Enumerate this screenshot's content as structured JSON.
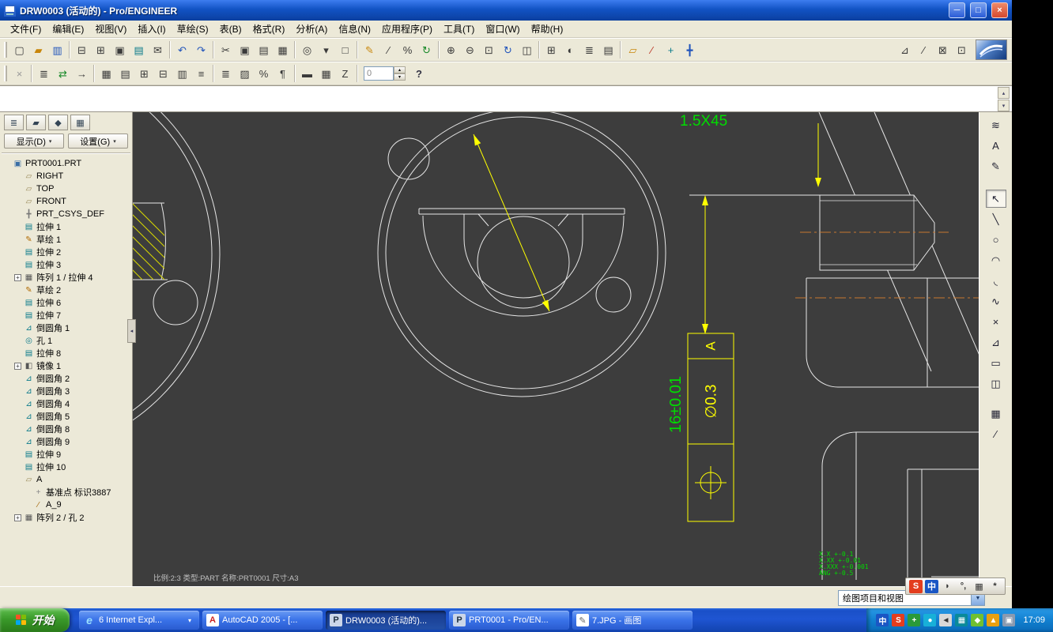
{
  "window": {
    "title": "DRW0003 (活动的) - Pro/ENGINEER"
  },
  "icons": {
    "minimize": "─",
    "maximize": "□",
    "close": "×",
    "caret_down": "▾",
    "combo_caret": "▼",
    "collapse_left": "◂",
    "scroll_up": "▴",
    "scroll_down": "▾",
    "spinner_up": "▴",
    "spinner_down": "▾",
    "help": "?"
  },
  "menu_bar": {
    "items": [
      "文件(F)",
      "编辑(E)",
      "视图(V)",
      "插入(I)",
      "草绘(S)",
      "表(B)",
      "格式(R)",
      "分析(A)",
      "信息(N)",
      "应用程序(P)",
      "工具(T)",
      "窗口(W)",
      "帮助(H)"
    ]
  },
  "toolbar_row1": {
    "groups": [
      [
        {
          "name": "new-file-button",
          "g": "▢",
          "c": "c-dark"
        },
        {
          "name": "open-file-button",
          "g": "▰",
          "c": "c-amber"
        },
        {
          "name": "save-file-button",
          "g": "▥",
          "c": "c-blue"
        }
      ],
      [
        {
          "name": "print-button",
          "g": "⊟",
          "c": "c-dark"
        },
        {
          "name": "print-preview-button",
          "g": "⊞",
          "c": "c-dark"
        },
        {
          "name": "copy-drawing-button",
          "g": "▣",
          "c": "c-dark"
        },
        {
          "name": "export-button",
          "g": "▤",
          "c": "c-teal"
        },
        {
          "name": "send-mail-button",
          "g": "✉",
          "c": "c-dark"
        }
      ],
      [
        {
          "name": "undo-button",
          "g": "↶",
          "c": "c-blue"
        },
        {
          "name": "redo-button",
          "g": "↷",
          "c": "c-blue"
        }
      ],
      [
        {
          "name": "cut-button",
          "g": "✂",
          "c": "c-dark"
        },
        {
          "name": "copy-button",
          "g": "▣",
          "c": "c-dark"
        },
        {
          "name": "paste-button",
          "g": "▤",
          "c": "c-dark"
        },
        {
          "name": "paste-special-button",
          "g": "▦",
          "c": "c-dark"
        }
      ],
      [
        {
          "name": "search-button",
          "g": "◎",
          "c": "c-dark"
        },
        {
          "name": "select-filter-button",
          "g": "▾",
          "c": "c-dark"
        },
        {
          "name": "select-box-button",
          "g": "□",
          "c": "c-dark"
        }
      ],
      [
        {
          "name": "sketch-mode-button",
          "g": "✎",
          "c": "c-amber"
        },
        {
          "name": "trim-button",
          "g": "∕",
          "c": "c-dark"
        },
        {
          "name": "divide-button",
          "g": "%",
          "c": "c-dark"
        },
        {
          "name": "regenerate-button",
          "g": "↻",
          "c": "c-green"
        }
      ],
      [
        {
          "name": "zoom-in-button",
          "g": "⊕",
          "c": "c-dark"
        },
        {
          "name": "zoom-out-button",
          "g": "⊖",
          "c": "c-dark"
        },
        {
          "name": "zoom-fit-button",
          "g": "⊡",
          "c": "c-dark"
        },
        {
          "name": "repaint-button",
          "g": "↻",
          "c": "c-blue"
        },
        {
          "name": "view-manager-button",
          "g": "◫",
          "c": "c-dark"
        }
      ],
      [
        {
          "name": "new-window-button",
          "g": "⊞",
          "c": "c-dark"
        },
        {
          "name": "window-shade-button",
          "g": "◐",
          "c": "c-dark"
        },
        {
          "name": "layer-display-button",
          "g": "≣",
          "c": "c-dark"
        },
        {
          "name": "model-tree-toggle-button",
          "g": "▤",
          "c": "c-dark"
        }
      ],
      [
        {
          "name": "datum-plane-display-toggle",
          "g": "▱",
          "c": "c-amber"
        },
        {
          "name": "datum-axis-display-toggle",
          "g": "∕",
          "c": "c-red"
        },
        {
          "name": "datum-point-display-toggle",
          "g": "+",
          "c": "c-teal"
        },
        {
          "name": "csys-display-toggle",
          "g": "╋",
          "c": "c-blue"
        }
      ],
      [
        {
          "name": "hidden-line-toggle",
          "g": "⊿",
          "c": "c-dark"
        },
        {
          "name": "tangent-edge-toggle",
          "g": "∕",
          "c": "c-dark"
        },
        {
          "name": "line-style-toggle",
          "g": "⊠",
          "c": "c-dark"
        },
        {
          "name": "text-style-toggle",
          "g": "⊡",
          "c": "c-dark"
        }
      ]
    ]
  },
  "toolbar_row2": {
    "groups": [
      [
        {
          "name": "close-button",
          "g": "×",
          "c": "c-gray"
        }
      ],
      [
        {
          "name": "item-list-button",
          "g": "≣",
          "c": "c-dark"
        },
        {
          "name": "update-sheets-button",
          "g": "⇄",
          "c": "c-green"
        },
        {
          "name": "goto-sheet-button",
          "g": "→",
          "c": "c-dark"
        }
      ],
      [
        {
          "name": "table-lock-button",
          "g": "▦",
          "c": "c-dark"
        },
        {
          "name": "insert-table-button",
          "g": "▤",
          "c": "c-dark"
        },
        {
          "name": "add-row-button",
          "g": "⊞",
          "c": "c-dark"
        },
        {
          "name": "add-column-button",
          "g": "⊟",
          "c": "c-dark"
        },
        {
          "name": "merge-cells-button",
          "g": "▥",
          "c": "c-dark"
        },
        {
          "name": "line-spacing-button",
          "g": "≡",
          "c": "c-dark"
        }
      ],
      [
        {
          "name": "align-button",
          "g": "≣",
          "c": "c-dark"
        },
        {
          "name": "hatch-button",
          "g": "▨",
          "c": "c-dark"
        },
        {
          "name": "scale-button",
          "g": "%",
          "c": "c-dark"
        },
        {
          "name": "format-button",
          "g": "¶",
          "c": "c-dark"
        }
      ],
      [
        {
          "name": "table-properties-button",
          "g": "▬",
          "c": "c-dark"
        },
        {
          "name": "repeat-region-button",
          "g": "▦",
          "c": "c-dark"
        },
        {
          "name": "switch-dimensions-button",
          "g": "Z",
          "c": "c-dark"
        }
      ]
    ],
    "spinner_value": "0"
  },
  "tree_panel": {
    "tabs": [
      {
        "name": "model-tree-tab-button",
        "g": "≣"
      },
      {
        "name": "folder-browser-button",
        "g": "▰"
      },
      {
        "name": "favorites-button",
        "g": "◆"
      },
      {
        "name": "connections-button",
        "g": "▦"
      }
    ],
    "show_label": "显示(D)",
    "settings_label": "设置(G)",
    "items": [
      {
        "label": "PRT0001.PRT",
        "glyph": "▣",
        "cls": "i-part",
        "exp": "",
        "ind": ""
      },
      {
        "label": "RIGHT",
        "glyph": "▱",
        "cls": "i-plane",
        "exp": "",
        "ind": "ind1"
      },
      {
        "label": "TOP",
        "glyph": "▱",
        "cls": "i-plane",
        "exp": "",
        "ind": "ind1"
      },
      {
        "label": "FRONT",
        "glyph": "▱",
        "cls": "i-plane",
        "exp": "",
        "ind": "ind1"
      },
      {
        "label": "PRT_CSYS_DEF",
        "glyph": "╋",
        "cls": "i-csys",
        "exp": "",
        "ind": "ind1"
      },
      {
        "label": "拉伸 1",
        "glyph": "▤",
        "cls": "i-feat",
        "exp": "",
        "ind": "ind1"
      },
      {
        "label": "草绘 1",
        "glyph": "✎",
        "cls": "i-sketch",
        "exp": "",
        "ind": "ind1"
      },
      {
        "label": "拉伸 2",
        "glyph": "▤",
        "cls": "i-feat",
        "exp": "",
        "ind": "ind1"
      },
      {
        "label": "拉伸 3",
        "glyph": "▤",
        "cls": "i-feat",
        "exp": "",
        "ind": "ind1"
      },
      {
        "label": "阵列 1 / 拉伸 4",
        "glyph": "▦",
        "cls": "i-pattern",
        "exp": "+",
        "ind": "ind1"
      },
      {
        "label": "草绘 2",
        "glyph": "✎",
        "cls": "i-sketch",
        "exp": "",
        "ind": "ind1"
      },
      {
        "label": "拉伸 6",
        "glyph": "▤",
        "cls": "i-feat",
        "exp": "",
        "ind": "ind1"
      },
      {
        "label": "拉伸 7",
        "glyph": "▤",
        "cls": "i-feat",
        "exp": "",
        "ind": "ind1"
      },
      {
        "label": "倒圆角 1",
        "glyph": "⊿",
        "cls": "i-round",
        "exp": "",
        "ind": "ind1"
      },
      {
        "label": "孔 1",
        "glyph": "◎",
        "cls": "i-hole",
        "exp": "",
        "ind": "ind1"
      },
      {
        "label": "拉伸 8",
        "glyph": "▤",
        "cls": "i-feat",
        "exp": "",
        "ind": "ind1"
      },
      {
        "label": "镜像 1",
        "glyph": "◧",
        "cls": "i-mirror",
        "exp": "+",
        "ind": "ind1"
      },
      {
        "label": "倒圆角 2",
        "glyph": "⊿",
        "cls": "i-round",
        "exp": "",
        "ind": "ind1"
      },
      {
        "label": "倒圆角 3",
        "glyph": "⊿",
        "cls": "i-round",
        "exp": "",
        "ind": "ind1"
      },
      {
        "label": "倒圆角 4",
        "glyph": "⊿",
        "cls": "i-round",
        "exp": "",
        "ind": "ind1"
      },
      {
        "label": "倒圆角 5",
        "glyph": "⊿",
        "cls": "i-round",
        "exp": "",
        "ind": "ind1"
      },
      {
        "label": "倒圆角 8",
        "glyph": "⊿",
        "cls": "i-round",
        "exp": "",
        "ind": "ind1"
      },
      {
        "label": "倒圆角 9",
        "glyph": "⊿",
        "cls": "i-round",
        "exp": "",
        "ind": "ind1"
      },
      {
        "label": "拉伸 9",
        "glyph": "▤",
        "cls": "i-feat",
        "exp": "",
        "ind": "ind1"
      },
      {
        "label": "拉伸 10",
        "glyph": "▤",
        "cls": "i-feat",
        "exp": "",
        "ind": "ind1"
      },
      {
        "label": "A",
        "glyph": "▱",
        "cls": "i-plane",
        "exp": "",
        "ind": "ind1"
      },
      {
        "label": "基准点 标识3887",
        "glyph": "+",
        "cls": "i-point",
        "exp": "",
        "ind": "ind2"
      },
      {
        "label": "A_9",
        "glyph": "∕",
        "cls": "i-axis",
        "exp": "",
        "ind": "ind2"
      },
      {
        "label": "阵列 2 / 孔 2",
        "glyph": "▦",
        "cls": "i-pattern",
        "exp": "+",
        "ind": "ind1"
      }
    ]
  },
  "right_toolbar": {
    "top_buttons": [
      {
        "name": "view-layers-button",
        "g": "≋"
      },
      {
        "name": "annotation-show-button",
        "g": "A"
      },
      {
        "name": "note-edit-button",
        "g": "✎"
      }
    ],
    "tools": [
      {
        "name": "select-tool",
        "g": "↖",
        "cls": "active"
      },
      {
        "name": "line-tool",
        "g": "╲",
        "cls": ""
      },
      {
        "name": "circle-tool",
        "g": "○",
        "cls": ""
      },
      {
        "name": "arc-tool",
        "g": "◠",
        "cls": ""
      },
      {
        "name": "fillet-tool",
        "g": "◟",
        "cls": ""
      },
      {
        "name": "spline-tool",
        "g": "∿",
        "cls": ""
      },
      {
        "name": "point-tool",
        "g": "×",
        "cls": ""
      },
      {
        "name": "chamfer-tool",
        "g": "⊿",
        "cls": ""
      },
      {
        "name": "offset-edge-tool",
        "g": "▭",
        "cls": ""
      },
      {
        "name": "use-edge-tool",
        "g": "◫",
        "cls": ""
      },
      {
        "name": "sketcher-palette-tool",
        "g": "▦",
        "cls": "gap-top"
      },
      {
        "name": "centerline-tool",
        "g": "∕",
        "cls": ""
      }
    ]
  },
  "drawing": {
    "chamfer_label": "1.5X45",
    "dim_label": "16±0.01",
    "fcf_datum": "A",
    "fcf_tolerance": "∅0.3",
    "tol_note_lines": [
      "X.X +-0.1",
      "X.XX +-0.01",
      "X.XXX +-0.001",
      "ANG +-0.5"
    ],
    "status_text": "比例:2:3  类型:PART  名称:PRT0001  尺寸:A3"
  },
  "bottom_bar": {
    "dropdown_label": "绘图项目和视图"
  },
  "ime_bar": {
    "icons": [
      {
        "name": "sogou-ime-icon",
        "g": "S",
        "c": "ime-red"
      },
      {
        "name": "ime-language-icon",
        "g": "中",
        "c": "ime-blue"
      },
      {
        "name": "ime-halfwidth-icon",
        "g": "◗",
        "c": "ime-dark"
      },
      {
        "name": "ime-punctuation-icon",
        "g": "°,",
        "c": "ime-dark"
      },
      {
        "name": "soft-keyboard-icon",
        "g": "▦",
        "c": "ime-dark"
      },
      {
        "name": "ime-tools-icon",
        "g": "*",
        "c": "ime-dark"
      }
    ]
  },
  "taskbar": {
    "start_label": "开始",
    "tasks": [
      {
        "label": "6 Internet Expl...",
        "icon_g": "e",
        "icon_cls": "ic-ie",
        "state": "",
        "chevron": "▾"
      },
      {
        "label": "AutoCAD 2005 - [...",
        "icon_g": "A",
        "icon_cls": "ic-acad",
        "state": "",
        "chevron": ""
      },
      {
        "label": "DRW0003 (活动的)...",
        "icon_g": "P",
        "icon_cls": "ic-proe",
        "state": "active",
        "chevron": ""
      },
      {
        "label": "PRT0001 - Pro/EN...",
        "icon_g": "P",
        "icon_cls": "ic-proe",
        "state": "",
        "chevron": ""
      },
      {
        "label": "7.JPG - 画图",
        "icon_g": "✎",
        "icon_cls": "ic-paint",
        "state": "",
        "chevron": ""
      }
    ],
    "tray": [
      {
        "name": "ime-indicator-tray-icon",
        "g": "中",
        "c": "tc-blue"
      },
      {
        "name": "sogou-tray-icon",
        "g": "S",
        "c": "tc-red"
      },
      {
        "name": "antivirus-tray-icon",
        "g": "+",
        "c": "tc-green"
      },
      {
        "name": "messenger-tray-icon",
        "g": "●",
        "c": "tc-cyan"
      },
      {
        "name": "volume-tray-icon",
        "g": "◄",
        "c": "tc-gray"
      },
      {
        "name": "network-tray-icon",
        "g": "▦",
        "c": "tc-teal"
      },
      {
        "name": "usb-device-tray-icon",
        "g": "◆",
        "c": "tc-green2"
      },
      {
        "name": "security-center-tray-icon",
        "g": "▲",
        "c": "tc-amber"
      },
      {
        "name": "display-settings-tray-icon",
        "g": "▣",
        "c": "tc-gray2"
      }
    ],
    "time": "17:09"
  }
}
